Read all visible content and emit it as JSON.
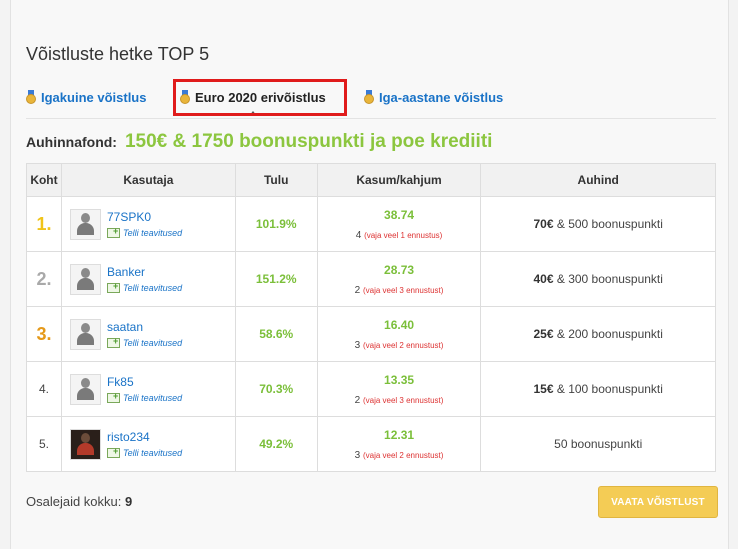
{
  "title": "Võistluste hetke TOP 5",
  "tabs": [
    {
      "label": "Igakuine võistlus",
      "active": false
    },
    {
      "label": "Euro 2020 erivõistlus",
      "active": true
    },
    {
      "label": "Iga-aastane võistlus",
      "active": false
    }
  ],
  "prize": {
    "label": "Auhinnafond:",
    "value": "150€ & 1750 boonuspunkti ja poe krediiti"
  },
  "table": {
    "headers": [
      "Koht",
      "Kasutaja",
      "Tulu",
      "Kasum/kahjum",
      "Auhind"
    ],
    "rows": [
      {
        "rank": "1.",
        "user": "77SPK0",
        "notify": "Telli teavitused",
        "yield": "101.9%",
        "profit": "38.74",
        "count": "4",
        "need": "(vaja veel 1 ennustus)",
        "reward_bold": "70€",
        "reward_rest": " & 500 boonuspunkti"
      },
      {
        "rank": "2.",
        "user": "Banker",
        "notify": "Telli teavitused",
        "yield": "151.2%",
        "profit": "28.73",
        "count": "2",
        "need": "(vaja veel 3 ennustust)",
        "reward_bold": "40€",
        "reward_rest": " & 300 boonuspunkti"
      },
      {
        "rank": "3.",
        "user": "saatan",
        "notify": "Telli teavitused",
        "yield": "58.6%",
        "profit": "16.40",
        "count": "3",
        "need": "(vaja veel 2 ennustust)",
        "reward_bold": "25€",
        "reward_rest": " & 200 boonuspunkti"
      },
      {
        "rank": "4.",
        "user": "Fk85",
        "notify": "Telli teavitused",
        "yield": "70.3%",
        "profit": "13.35",
        "count": "2",
        "need": "(vaja veel 3 ennustust)",
        "reward_bold": "15€",
        "reward_rest": " & 100 boonuspunkti"
      },
      {
        "rank": "5.",
        "user": "risto234",
        "notify": "Telli teavitused",
        "yield": "49.2%",
        "profit": "12.31",
        "count": "3",
        "need": "(vaja veel 2 ennustust)",
        "reward_bold": "",
        "reward_rest": "50 boonuspunkti"
      }
    ]
  },
  "footer": {
    "participants_label": "Osalejaid kokku:",
    "participants_value": "9",
    "button": "VAATA VÕISTLUST"
  },
  "colors": {
    "accent_green": "#8cc63f",
    "link_blue": "#1a73c7",
    "button_yellow": "#f4cc55",
    "highlight_red": "#e01b1b"
  }
}
